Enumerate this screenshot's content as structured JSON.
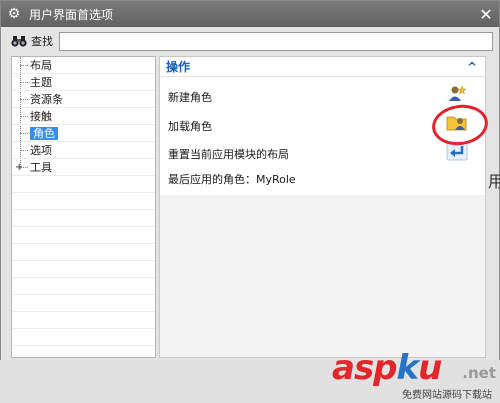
{
  "window": {
    "title": "用户界面首选项"
  },
  "search": {
    "label": "查找",
    "value": "",
    "placeholder": ""
  },
  "tree": {
    "items": [
      {
        "label": "布局",
        "selected": false
      },
      {
        "label": "主题",
        "selected": false
      },
      {
        "label": "资源条",
        "selected": false
      },
      {
        "label": "接触",
        "selected": false
      },
      {
        "label": "角色",
        "selected": true
      },
      {
        "label": "选项",
        "selected": false
      },
      {
        "label": "工具",
        "selected": false,
        "expander": "+"
      }
    ]
  },
  "section": {
    "title": "操作",
    "collapse_glyph": "^",
    "rows": [
      {
        "label": "新建角色",
        "icon": "new-role-icon"
      },
      {
        "label": "加载角色",
        "icon": "load-role-folder-icon"
      },
      {
        "label": "重置当前应用模块的布局",
        "icon": "reset-layout-icon"
      },
      {
        "label": "最后应用的角色：MyRole"
      }
    ]
  },
  "watermark": {
    "brand_a": "asp",
    "brand_b": "k",
    "brand_c": "u",
    "domain": ".net",
    "tagline": "免费网站源码下载站"
  },
  "edge": {
    "glyph": "用"
  },
  "colors": {
    "selection": "#3a8ee6",
    "section_title": "#1d5fb4",
    "annotation": "#e8202a",
    "titlebar": "#6e6e6e"
  }
}
